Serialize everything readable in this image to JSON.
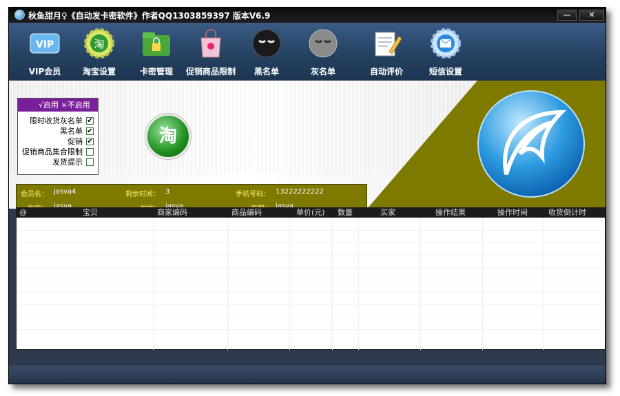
{
  "window": {
    "title": "秋鱼甜月♀《自动发卡密软件》作者QQ1303859397 版本V6.9",
    "minimize_label": "—",
    "close_label": "✕"
  },
  "toolbar": {
    "items": [
      {
        "label": "VIP会员",
        "icon": "vip-icon"
      },
      {
        "label": "淘宝设置",
        "icon": "taobao-settings-icon"
      },
      {
        "label": "卡密管理",
        "icon": "card-lock-icon"
      },
      {
        "label": "促销商品限制",
        "icon": "shopping-bag-icon"
      },
      {
        "label": "黑名单",
        "icon": "black-face-icon"
      },
      {
        "label": "灰名单",
        "icon": "gray-face-icon"
      },
      {
        "label": "自动评价",
        "icon": "notepad-pencil-icon"
      },
      {
        "label": "短信设置",
        "icon": "envelope-gear-icon"
      }
    ],
    "taobao_glyph": "淘"
  },
  "options": {
    "header": "√启用 ×不启用",
    "rows": [
      {
        "label": "限时收货灰名单",
        "checked": true,
        "mark": "✔"
      },
      {
        "label": "黑名单",
        "checked": true,
        "mark": "✔"
      },
      {
        "label": "促销",
        "checked": true,
        "mark": "✔"
      },
      {
        "label": "促销商品集合限制",
        "checked": false,
        "mark": ""
      },
      {
        "label": "发货提示",
        "checked": false,
        "mark": ""
      }
    ]
  },
  "taobao_button": {
    "glyph": "淘"
  },
  "account": {
    "member_label": "会员名：",
    "member_value": "jasva4",
    "remaining_label": "剩余时间：",
    "remaining_value": "3",
    "phone_label": "手机号码：",
    "phone_value": "13222222222",
    "taobao_label": "淘宝：",
    "taobao_value": "jasva",
    "paipai_label": "拍拍：",
    "paipai_value": "jasva",
    "youa_label": "有啊：",
    "youa_value": "jasva"
  },
  "table": {
    "columns": [
      "@",
      "宝贝",
      "商家编码",
      "商品编码",
      "单价(元)",
      "数量",
      "买家",
      "操作结果",
      "操作时间",
      "收货倒计时"
    ],
    "rows": []
  },
  "colors": {
    "olive": "#7e7a00",
    "toolbar": "#2b4a70",
    "options_header": "#7a1f9a"
  }
}
